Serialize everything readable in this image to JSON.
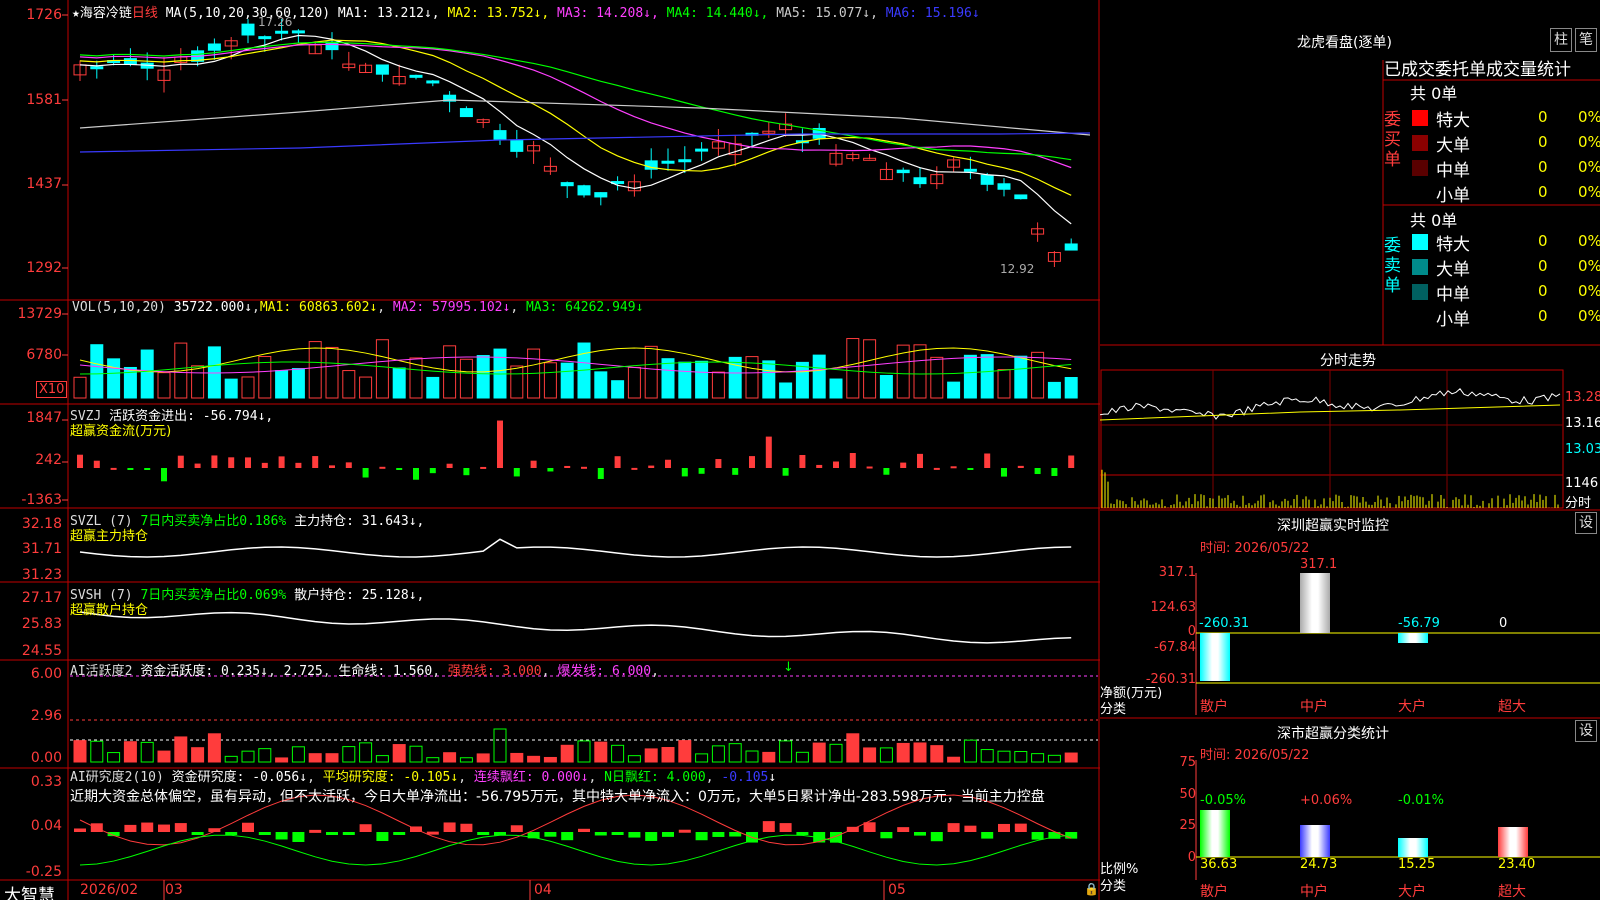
{
  "app": {
    "name": "大智慧"
  },
  "stock": {
    "star": "★",
    "name": "海容冷链",
    "period": "日线"
  },
  "kline": {
    "ma_label": "MA(5,10,20,30,60,120)",
    "ma": [
      {
        "label": "MA1: 13.212",
        "arrow": "↓",
        "color": "#ffffff"
      },
      {
        "label": "MA2: 13.752",
        "arrow": "↓",
        "color": "#ffff00"
      },
      {
        "label": "MA3: 14.208",
        "arrow": "↓",
        "color": "#ff40ff"
      },
      {
        "label": "MA4: 14.440",
        "arrow": "↓",
        "color": "#00ff00"
      },
      {
        "label": "MA5: 15.077",
        "arrow": "↓",
        "color": "#cccccc"
      },
      {
        "label": "MA6: 15.196",
        "arrow": "↓",
        "color": "#3a3aff"
      }
    ],
    "yticks": [
      "1726",
      "1581",
      "1437",
      "1292"
    ],
    "high_label": "17.26",
    "low_label": "12.92"
  },
  "vol": {
    "title": "VOL(5,10,20)",
    "value": "35722.000",
    "ma1": "MA1: 60863.602",
    "ma2": "MA2: 57995.102",
    "ma3": "MA3: 64262.949",
    "arrow": "↓",
    "yticks": [
      "13729",
      "6780"
    ],
    "multiplier": "X10"
  },
  "svzj": {
    "title": "SVZJ",
    "label": "活跃资金进出: -56.794",
    "arrow": "↓,",
    "name": "超赢资金流(万元)",
    "yticks": [
      "1847",
      "242",
      "-1363"
    ]
  },
  "svzl": {
    "title": "SVZL (7)",
    "ratio": "7日内买卖净占比0.186%",
    "hold": "主力持仓: 31.643",
    "arrow": "↓,",
    "name": "超赢主力持仓",
    "yticks": [
      "32.18",
      "31.71",
      "31.23"
    ]
  },
  "svsh": {
    "title": "SVSH (7)",
    "ratio": "7日内买卖净占比0.069%",
    "hold": "散户持仓: 25.128",
    "arrow": "↓,",
    "name": "超赢散户持仓",
    "yticks": [
      "27.17",
      "25.83",
      "24.55"
    ]
  },
  "ai_active": {
    "title": "AI活跃度2",
    "label1": "资金活跃度: 0.235",
    "label2": "2.725",
    "label3": "生命线: 1.560",
    "label4": "强势线: 3.000",
    "label5": "爆发线: 6.000",
    "arrow": "↓",
    "yticks": [
      "6.00",
      "2.96",
      "0.00"
    ]
  },
  "ai_research": {
    "title": "AI研究度2(10)",
    "label1": "资金研究度: -0.056",
    "label2": "平均研究度: -0.105",
    "label3": "连续飘红: 0.000",
    "label4": "N日飘红: 4.000",
    "label5": "-0.105",
    "arrow": "↓",
    "comment": "近期大资金总体偏空，虽有异动，但不太活跃，今日大单净流出：-56.795万元，其中特大单净流入：0万元，大单5日累计净出-283.598万元，当前主力控盘",
    "yticks": [
      "0.33",
      "0.04",
      "-0.25"
    ]
  },
  "timeline": {
    "labels": [
      "2026/02",
      "03",
      "04",
      "05"
    ]
  },
  "dragon": {
    "title": "龙虎看盘(逐单)",
    "btn_a": "柱",
    "btn_b": "笔",
    "subtitle": "已成交委托单成交量统计",
    "buy_side": "委买单",
    "sell_side": "委卖单",
    "buy_total": "共 0单",
    "sell_total": "共 0单",
    "buy_rows": [
      {
        "label": "特大",
        "value": "0",
        "pct": "0%",
        "color": "#ff0000"
      },
      {
        "label": "大单",
        "value": "0",
        "pct": "0%",
        "color": "#8b0000"
      },
      {
        "label": "中单",
        "value": "0",
        "pct": "0%",
        "color": "#5a0000"
      },
      {
        "label": "小单",
        "value": "0",
        "pct": "0%",
        "color": ""
      }
    ],
    "sell_rows": [
      {
        "label": "特大",
        "value": "0",
        "pct": "0%",
        "color": "#00ffff"
      },
      {
        "label": "大单",
        "value": "0",
        "pct": "0%",
        "color": "#008b8b"
      },
      {
        "label": "中单",
        "value": "0",
        "pct": "0%",
        "color": "#006060"
      },
      {
        "label": "小单",
        "value": "0",
        "pct": "0%",
        "color": ""
      }
    ]
  },
  "intraday": {
    "title": "分时走势",
    "yticks": [
      "13.28",
      "13.16",
      "13.03",
      "1146"
    ],
    "label_fen": "分时"
  },
  "sz_monitor": {
    "title": "深圳超赢实时监控",
    "settings": "设",
    "time": "时间: 2026/05/22",
    "yticks": [
      "317.1",
      "124.63",
      "0",
      "-67.84",
      "-260.31"
    ],
    "ylabel": "净额(万元)",
    "xlabel": "分类",
    "categories": [
      "散户",
      "中户",
      "大户",
      "超大"
    ],
    "values": [
      "-260.31",
      "317.1",
      "-56.79",
      "0"
    ]
  },
  "sz_class": {
    "title": "深市超赢分类统计",
    "settings": "设",
    "time": "时间: 2026/05/22",
    "yticks": [
      "75",
      "50",
      "25",
      "0"
    ],
    "ylabel": "比例%",
    "xlabel": "分类",
    "categories": [
      "散户",
      "中户",
      "大户",
      "超大"
    ],
    "change": [
      "-0.05%",
      "+0.06%",
      "-0.01%",
      ""
    ],
    "values": [
      "36.63",
      "24.73",
      "15.25",
      "23.40"
    ]
  },
  "colors": {
    "up": "#ff3c3c",
    "down": "#00ffff",
    "grid": "#c00000",
    "green": "#00ff00",
    "yellow": "#ffff00",
    "magenta": "#ff40ff"
  }
}
